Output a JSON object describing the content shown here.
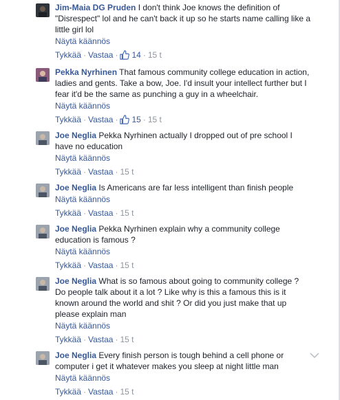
{
  "actions": {
    "like_label": "Tykkää",
    "reply_label": "Vastaa",
    "separator": "·",
    "translate_label": "Näytä käännös"
  },
  "comments": [
    {
      "author": "Jim-Maia DG Pruden",
      "text": "I don't think Joe knows the definition of \"Disrespect\" lol and he can't back it up so he starts name calling like a little girl lol",
      "likes": "14",
      "time": "15 t",
      "avatar_color": "#3a3f47"
    },
    {
      "author": "Pekka Nyrhinen",
      "text": "That famous community college education in action, ladies and gents. Take a bow, Joe. I'd insult your intellect further but I fear it'd be the same as punching a guy in a wheelchair.",
      "likes": "15",
      "time": "15 t",
      "avatar_color": "#7a4e6b"
    },
    {
      "author": "Joe Neglia",
      "text": "Pekka Nyrhinen actually I dropped out of pre school I have no education",
      "time": "15 t",
      "avatar_color": "#8d96a3"
    },
    {
      "author": "Joe Neglia",
      "text": "Is Americans are far less intelligent than finish people",
      "time": "15 t",
      "avatar_color": "#8d96a3"
    },
    {
      "author": "Joe Neglia",
      "text": "Pekka Nyrhinen explain why a community college education is famous ?",
      "time": "15 t",
      "avatar_color": "#8d96a3"
    },
    {
      "author": "Joe Neglia",
      "text": "What is so famous about going to community college ? Do people talk about it a lot ? Like why is this a famous this is it known around the world and shit ? Or did you just make that up please explain man",
      "time": "15 t",
      "avatar_color": "#8d96a3"
    },
    {
      "author": "Joe Neglia",
      "text": "Every finish person is tough behind a cell phone or computer i get it whatever makes you sleep at night little man",
      "time": "15 t",
      "avatar_color": "#8d96a3"
    }
  ],
  "colors": {
    "link": "#365899",
    "meta": "#90949c",
    "text": "#1d2129"
  }
}
